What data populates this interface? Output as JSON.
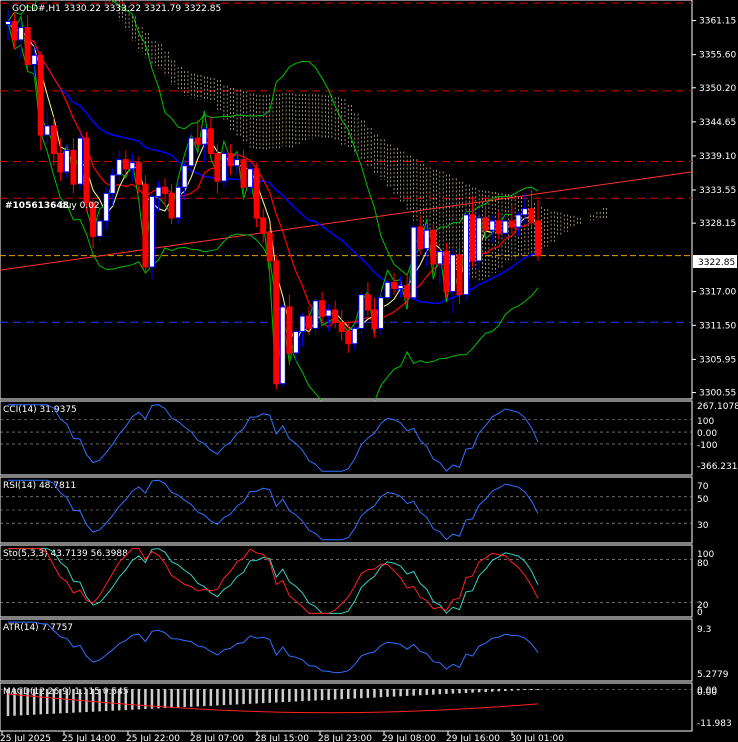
{
  "symbol_header": "GOLD#,H1  3330.22 3333.22 3321.79 3322.85",
  "order_label_id": "#105613648",
  "order_label_side": "buy 0.02",
  "current_price_label": "3322.85",
  "colors": {
    "bull": "#0000ff",
    "bear": "#ff0000",
    "bull_fill": "#ffffff",
    "bear_fill": "#ff0000",
    "bg": "#000000",
    "ichimoku": "#ffe4b5",
    "bands": "#00c000",
    "tenkan": "#ff0000",
    "kijun": "#0000ff",
    "fast_ma": "#ffff99"
  },
  "chart_data": [
    {
      "type": "candlestick",
      "title": "GOLD#,H1",
      "y_ticks": [
        "3361.15",
        "3355.60",
        "3350.20",
        "3344.65",
        "3339.10",
        "3333.55",
        "3328.15",
        "3322.85",
        "3317.00",
        "3311.50",
        "3305.95",
        "3300.55"
      ],
      "ylim": [
        3299.5,
        3364.5
      ],
      "x_labels": [
        "25 Jul 2025",
        "25 Jul 14:00",
        "25 Jul 22:00",
        "28 Jul 07:00",
        "28 Jul 15:00",
        "28 Jul 23:00",
        "29 Jul 08:00",
        "29 Jul 16:00",
        "30 Jul 01:00"
      ],
      "horizontal_levels": {
        "red_dashed": [
          3364.0,
          3349.7,
          3338.2,
          3332.2
        ],
        "blue_dashed": [
          3312.0
        ],
        "current_price": 3322.85
      },
      "candles_ohlc": [
        [
          3360.5,
          3363.0,
          3358.0,
          3361.0
        ],
        [
          3361.0,
          3362.5,
          3356.5,
          3358.0
        ],
        [
          3358.0,
          3361.0,
          3355.0,
          3360.0
        ],
        [
          3360.0,
          3362.0,
          3353.0,
          3354.0
        ],
        [
          3354.0,
          3357.0,
          3352.0,
          3355.5
        ],
        [
          3355.5,
          3356.0,
          3340.0,
          3342.5
        ],
        [
          3342.5,
          3346.5,
          3341.0,
          3344.0
        ],
        [
          3344.0,
          3345.5,
          3337.5,
          3339.5
        ],
        [
          3339.5,
          3342.0,
          3335.0,
          3336.5
        ],
        [
          3336.5,
          3341.0,
          3335.5,
          3340.0
        ],
        [
          3340.0,
          3342.0,
          3333.0,
          3334.5
        ],
        [
          3334.5,
          3343.0,
          3333.5,
          3342.0
        ],
        [
          3342.0,
          3343.0,
          3330.0,
          3331.5
        ],
        [
          3331.5,
          3332.0,
          3324.0,
          3326.0
        ],
        [
          3326.0,
          3330.0,
          3325.0,
          3328.5
        ],
        [
          3328.5,
          3334.0,
          3327.0,
          3333.0
        ],
        [
          3333.0,
          3337.0,
          3331.0,
          3336.0
        ],
        [
          3336.0,
          3340.0,
          3335.0,
          3338.5
        ],
        [
          3338.5,
          3340.0,
          3335.5,
          3337.0
        ],
        [
          3337.0,
          3339.5,
          3335.0,
          3338.0
        ],
        [
          3338.0,
          3339.0,
          3333.0,
          3334.5
        ],
        [
          3334.5,
          3336.0,
          3320.0,
          3321.0
        ],
        [
          3321.0,
          3333.0,
          3319.0,
          3332.5
        ],
        [
          3332.5,
          3335.0,
          3330.0,
          3334.0
        ],
        [
          3334.0,
          3335.5,
          3331.0,
          3333.0
        ],
        [
          3333.0,
          3334.5,
          3328.0,
          3329.0
        ],
        [
          3329.0,
          3335.0,
          3328.0,
          3334.0
        ],
        [
          3334.0,
          3338.5,
          3332.0,
          3337.5
        ],
        [
          3337.5,
          3343.0,
          3336.0,
          3342.0
        ],
        [
          3342.0,
          3345.0,
          3340.0,
          3341.0
        ],
        [
          3341.0,
          3344.0,
          3338.0,
          3343.5
        ],
        [
          3343.5,
          3345.5,
          3339.0,
          3339.5
        ],
        [
          3339.5,
          3341.0,
          3333.0,
          3335.0
        ],
        [
          3335.0,
          3340.0,
          3334.0,
          3339.5
        ],
        [
          3339.5,
          3341.0,
          3336.0,
          3337.5
        ],
        [
          3337.5,
          3339.5,
          3336.0,
          3338.5
        ],
        [
          3338.5,
          3340.0,
          3332.0,
          3334.0
        ],
        [
          3334.0,
          3338.0,
          3333.0,
          3337.0
        ],
        [
          3337.0,
          3338.0,
          3327.5,
          3329.0
        ],
        [
          3329.0,
          3330.5,
          3325.0,
          3326.5
        ],
        [
          3326.5,
          3328.0,
          3320.0,
          3322.0
        ],
        [
          3322.0,
          3323.0,
          3301.0,
          3302.0
        ],
        [
          3302.0,
          3315.0,
          3301.5,
          3314.5
        ],
        [
          3314.5,
          3316.5,
          3305.0,
          3307.0
        ],
        [
          3307.0,
          3311.0,
          3305.5,
          3310.5
        ],
        [
          3310.5,
          3313.5,
          3308.0,
          3313.0
        ],
        [
          3313.0,
          3314.5,
          3310.0,
          3311.0
        ],
        [
          3311.0,
          3316.0,
          3310.0,
          3315.5
        ],
        [
          3315.5,
          3317.0,
          3312.0,
          3313.0
        ],
        [
          3313.0,
          3315.0,
          3310.5,
          3314.0
        ],
        [
          3314.0,
          3315.5,
          3311.0,
          3312.0
        ],
        [
          3312.0,
          3314.0,
          3309.0,
          3310.5
        ],
        [
          3310.5,
          3312.0,
          3307.0,
          3308.5
        ],
        [
          3308.5,
          3311.5,
          3307.5,
          3311.0
        ],
        [
          3311.0,
          3317.0,
          3310.0,
          3316.5
        ],
        [
          3316.5,
          3318.5,
          3313.0,
          3314.0
        ],
        [
          3314.0,
          3316.0,
          3309.5,
          3311.0
        ],
        [
          3311.0,
          3317.0,
          3310.0,
          3316.0
        ],
        [
          3316.0,
          3319.0,
          3315.0,
          3318.5
        ],
        [
          3318.5,
          3320.0,
          3316.5,
          3317.5
        ],
        [
          3317.5,
          3319.5,
          3316.0,
          3318.0
        ],
        [
          3318.0,
          3320.0,
          3315.0,
          3316.0
        ],
        [
          3316.0,
          3328.5,
          3315.5,
          3327.5
        ],
        [
          3327.5,
          3329.5,
          3323.0,
          3324.0
        ],
        [
          3324.0,
          3328.0,
          3321.0,
          3327.0
        ],
        [
          3327.0,
          3328.0,
          3320.0,
          3321.5
        ],
        [
          3321.5,
          3324.0,
          3318.0,
          3323.5
        ],
        [
          3323.5,
          3325.0,
          3316.0,
          3317.0
        ],
        [
          3317.0,
          3324.0,
          3313.5,
          3323.0
        ],
        [
          3323.0,
          3325.0,
          3315.0,
          3316.5
        ],
        [
          3316.5,
          3330.0,
          3315.5,
          3329.5
        ],
        [
          3329.5,
          3332.5,
          3321.0,
          3322.0
        ],
        [
          3322.0,
          3330.5,
          3320.5,
          3329.0
        ],
        [
          3329.0,
          3331.0,
          3326.0,
          3327.0
        ],
        [
          3327.0,
          3329.5,
          3325.0,
          3328.5
        ],
        [
          3328.5,
          3330.0,
          3325.5,
          3326.5
        ],
        [
          3326.5,
          3329.5,
          3325.5,
          3328.5
        ],
        [
          3328.5,
          3331.0,
          3326.5,
          3327.5
        ],
        [
          3327.5,
          3330.0,
          3326.0,
          3329.5
        ],
        [
          3329.5,
          3333.0,
          3328.0,
          3330.5
        ],
        [
          3330.5,
          3333.5,
          3327.5,
          3328.5
        ],
        [
          3328.5,
          3332.0,
          3322.0,
          3322.85
        ]
      ]
    },
    {
      "type": "line",
      "title": "CCI(14) 31.9375",
      "y_ticks": [
        "267.1078",
        "100",
        "0.00",
        "-100",
        "-366.2315"
      ]
    },
    {
      "type": "line",
      "title": "RSI(14) 48.7811",
      "y_ticks": [
        "70",
        "50",
        "30"
      ]
    },
    {
      "type": "line",
      "title": "Sto(5,3,3) 43.7139 56.3988",
      "y_ticks": [
        "100",
        "80",
        "20",
        "0"
      ]
    },
    {
      "type": "line",
      "title": "ATR(14) 7.7757",
      "y_ticks": [
        "9.3",
        "5.2779"
      ]
    },
    {
      "type": "bar",
      "title": "MACD(12,26,9) 1.115 0.545",
      "y_ticks": [
        "0.00",
        "0.00",
        "-11.983"
      ]
    }
  ]
}
